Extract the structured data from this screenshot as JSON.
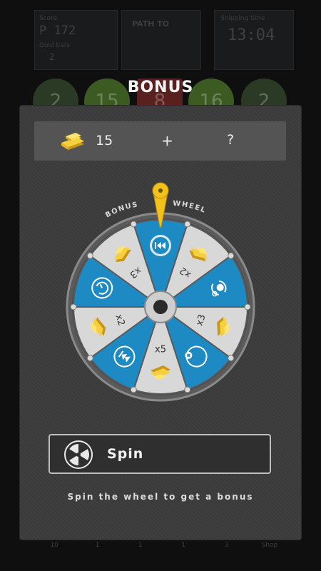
{
  "background": {
    "left_label_1": "Score",
    "left_value_1": "P 172",
    "left_label_2": "Gold bars",
    "left_value_2": "2",
    "mid_label": "PATH TO",
    "right_label": "Shipping time",
    "right_value": "13:04",
    "circles": [
      "2",
      "15",
      "8",
      "16",
      "2"
    ],
    "bottom_tabs": [
      "10",
      "1",
      "1",
      "1",
      "3",
      "Shop"
    ]
  },
  "modal": {
    "title": "BONUS",
    "gold_amount": "15",
    "plus": "+",
    "unknown": "?",
    "wheel_label_left": "BONUS",
    "wheel_label_right": "WHEEL",
    "segments": [
      {
        "id": "rewind",
        "color": "#1e8ac3",
        "icon": "rewind-icon"
      },
      {
        "id": "gold-x2",
        "color": "#d8d8d8",
        "label": "x2"
      },
      {
        "id": "refresh",
        "color": "#1e8ac3",
        "icon": "refresh-icon"
      },
      {
        "id": "gold-x3-right",
        "color": "#d8d8d8",
        "label": "x3"
      },
      {
        "id": "add-time",
        "color": "#1e8ac3",
        "icon": "add-time-icon"
      },
      {
        "id": "gold-x5",
        "color": "#d8d8d8",
        "label": "x5"
      },
      {
        "id": "skip",
        "color": "#1e8ac3",
        "icon": "skip-icon"
      },
      {
        "id": "gold-x2-left",
        "color": "#d8d8d8",
        "label": "x2"
      },
      {
        "id": "time",
        "color": "#1e8ac3",
        "icon": "clock-icon"
      },
      {
        "id": "gold-x3-left",
        "color": "#d8d8d8",
        "label": "x3"
      }
    ],
    "spin_label": "Spin",
    "help_text": "Spin the wheel to get a bonus",
    "accent_blue": "#1e8ac3",
    "pointer_gold": "#f2c21b"
  }
}
